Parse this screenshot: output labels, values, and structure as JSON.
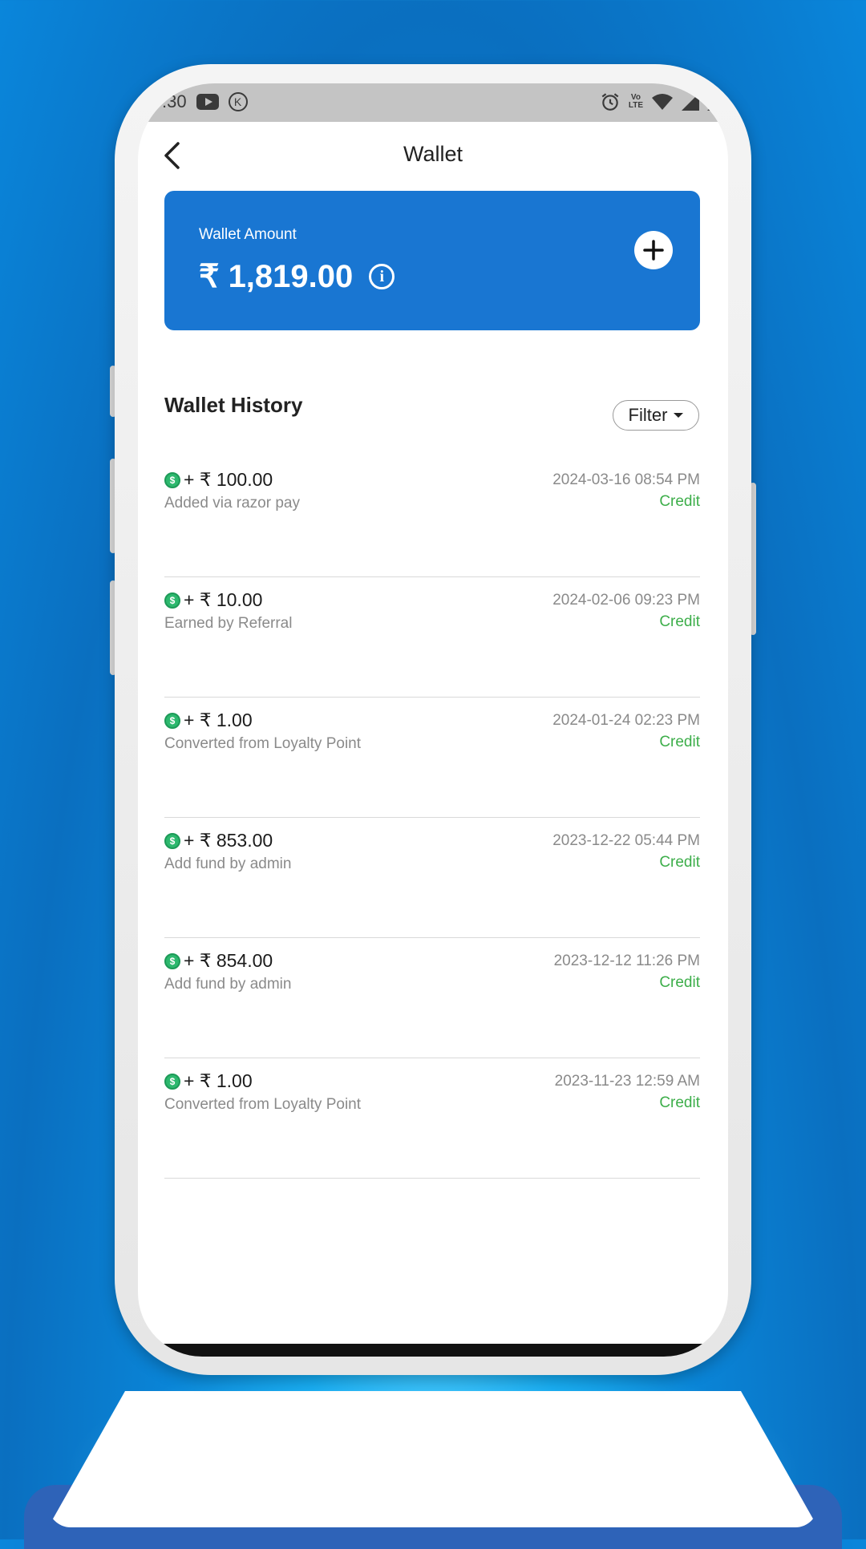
{
  "status_bar": {
    "time": ":30",
    "lte_top": "Vo",
    "lte_bottom": "LTE",
    "k_badge": "K",
    "icons": [
      "youtube-icon",
      "k-icon",
      "alarm-icon",
      "volte-icon",
      "wifi-icon",
      "signal-icon",
      "signal-icon-2"
    ]
  },
  "header": {
    "title": "Wallet",
    "back_icon": "chevron-left-icon"
  },
  "wallet_card": {
    "label": "Wallet Amount",
    "amount": "₹ 1,819.00",
    "info_icon": "i",
    "add_icon": "plus-icon",
    "color": "#1976d2"
  },
  "history": {
    "title": "Wallet History",
    "filter_label": "Filter",
    "transactions": [
      {
        "amount": "+ ₹ 100.00",
        "description": "Added via razor pay",
        "date": "2024-03-16 08:54 PM",
        "type": "Credit"
      },
      {
        "amount": "+ ₹ 10.00",
        "description": "Earned by Referral",
        "date": "2024-02-06 09:23 PM",
        "type": "Credit"
      },
      {
        "amount": "+ ₹ 1.00",
        "description": "Converted from Loyalty Point",
        "date": "2024-01-24 02:23 PM",
        "type": "Credit"
      },
      {
        "amount": "+ ₹ 853.00",
        "description": "Add fund by admin",
        "date": "2023-12-22 05:44 PM",
        "type": "Credit"
      },
      {
        "amount": "+ ₹ 854.00",
        "description": "Add fund by admin",
        "date": "2023-12-12 11:26 PM",
        "type": "Credit"
      },
      {
        "amount": "+ ₹ 1.00",
        "description": "Converted from Loyalty Point",
        "date": "2023-11-23 12:59 AM",
        "type": "Credit"
      }
    ],
    "coin_glyph": "$",
    "credit_color": "#3dae4a"
  }
}
